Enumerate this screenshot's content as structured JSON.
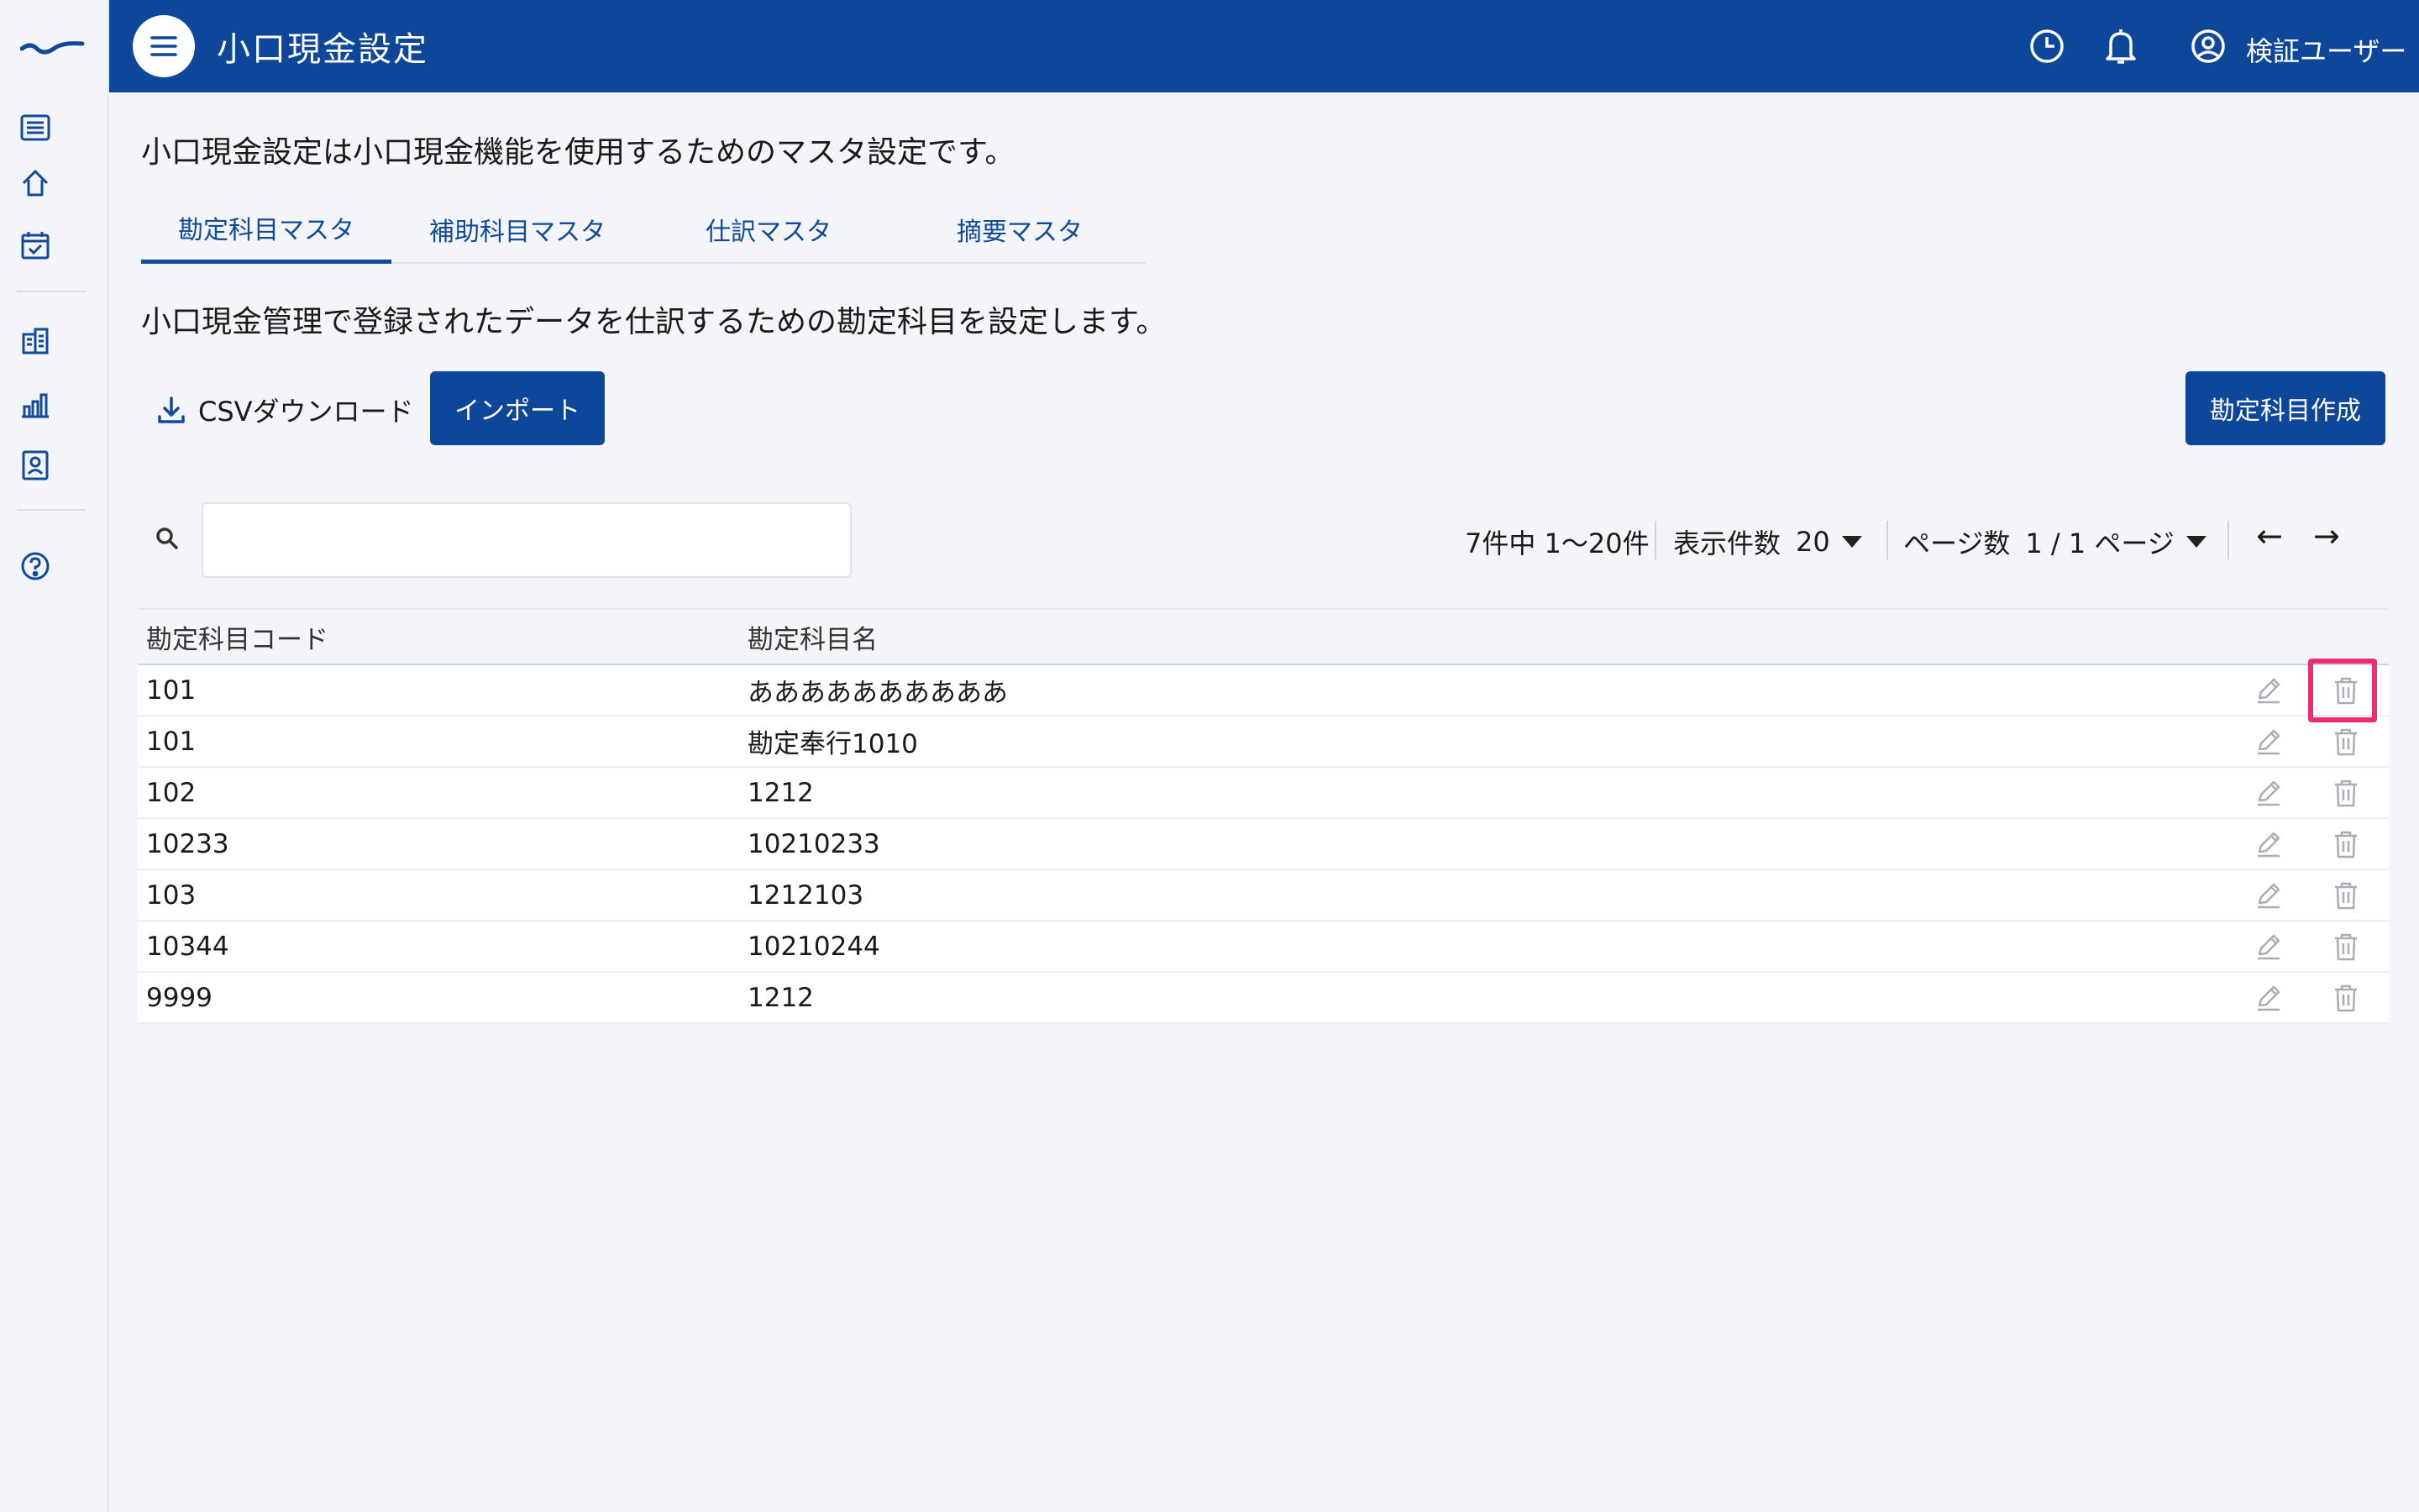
{
  "header": {
    "title": "小口現金設定",
    "user_name": "検証ユーザー",
    "icons": [
      "menu-icon",
      "history-clock-icon",
      "bell-icon",
      "user-circle-icon"
    ]
  },
  "rail": {
    "icons": [
      "brand-logo",
      "list-icon",
      "home-icon",
      "calendar-check-icon",
      "building-icon",
      "bar-chart-icon",
      "id-badge-icon",
      "help-icon"
    ]
  },
  "intro_text": "小口現金設定は小口現金機能を使用するためのマスタ設定です。",
  "tabs": [
    {
      "label": "勘定科目マスタ",
      "active": true
    },
    {
      "label": "補助科目マスタ",
      "active": false
    },
    {
      "label": "仕訳マスタ",
      "active": false
    },
    {
      "label": "摘要マスタ",
      "active": false
    }
  ],
  "description": "小口現金管理で登録されたデータを仕訳するための勘定科目を設定します。",
  "toolbar": {
    "csv_label": "CSVダウンロード",
    "import_label": "インポート",
    "create_label": "勘定科目作成"
  },
  "search": {
    "value": "",
    "placeholder": ""
  },
  "pager": {
    "summary": "7件中 1〜20件",
    "per_page_label": "表示件数",
    "per_page_value": "20",
    "page_label": "ページ数",
    "page_value": "1 / 1 ページ",
    "prev": "←",
    "next": "→"
  },
  "table": {
    "columns": [
      "勘定科目コード",
      "勘定科目名"
    ],
    "rows": [
      {
        "code": "101",
        "name": "ああああああああああ"
      },
      {
        "code": "101",
        "name": "勘定奉行1010"
      },
      {
        "code": "102",
        "name": "1212"
      },
      {
        "code": "10233",
        "name": "10210233"
      },
      {
        "code": "103",
        "name": "1212103"
      },
      {
        "code": "10344",
        "name": "10210244"
      },
      {
        "code": "9999",
        "name": "1212"
      }
    ]
  },
  "colors": {
    "brand": "#0e4699",
    "highlight": "#ee2c6f",
    "background": "#f4f5f8"
  }
}
